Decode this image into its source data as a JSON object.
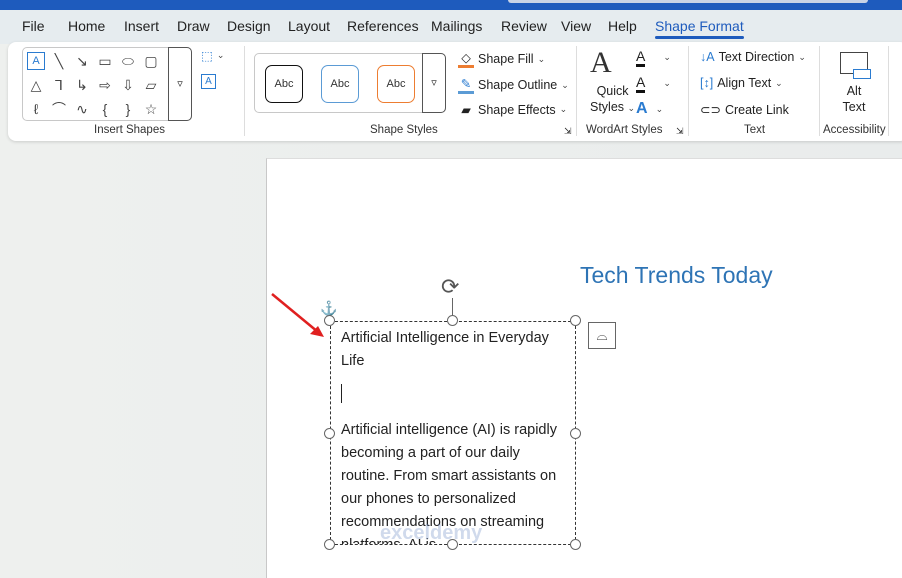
{
  "tabs": [
    "File",
    "Home",
    "Insert",
    "Draw",
    "Design",
    "Layout",
    "References",
    "Mailings",
    "Review",
    "View",
    "Help",
    "Shape Format"
  ],
  "active_tab": "Shape Format",
  "ribbon": {
    "insert_shapes": {
      "label": "Insert Shapes"
    },
    "shape_styles": {
      "label": "Shape Styles",
      "presets": [
        "Abc",
        "Abc",
        "Abc"
      ],
      "shape_fill": "Shape Fill",
      "shape_outline": "Shape Outline",
      "shape_effects": "Shape Effects"
    },
    "wordart_styles": {
      "label": "WordArt Styles",
      "quick_styles_1": "Quick",
      "quick_styles_2": "Styles"
    },
    "text": {
      "label": "Text",
      "text_direction": "Text Direction",
      "align_text": "Align Text",
      "create_link": "Create Link"
    },
    "accessibility": {
      "label": "Accessibility",
      "alt_text_1": "Alt",
      "alt_text_2": "Text"
    }
  },
  "document": {
    "title": "Tech Trends Today",
    "textbox": {
      "heading": "Artificial Intelligence in Everyday Life",
      "body": "Artificial intelligence (AI) is rapidly becoming a part of our daily routine. From smart assistants on our phones to personalized recommendations on streaming platforms, AI is"
    },
    "watermark": "exceldemy"
  },
  "colors": {
    "accent": "#1e5bbd",
    "title": "#2e74b5",
    "arrow": "#e02020"
  }
}
